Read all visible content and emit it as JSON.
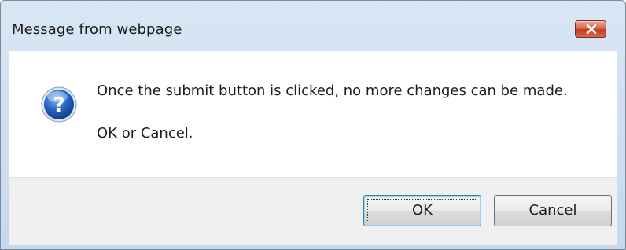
{
  "window": {
    "title": "Message from webpage"
  },
  "dialog": {
    "icon": "question-icon",
    "message_line1": "Once the submit button is clicked, no more changes can be made.",
    "message_line2": "OK or Cancel."
  },
  "buttons": {
    "ok_label": "OK",
    "cancel_label": "Cancel"
  },
  "colors": {
    "titlebar": "#c6d8ec",
    "close_button": "#c23a1d",
    "icon_blue": "#1f5fbf",
    "footer": "#f0f0f0"
  }
}
